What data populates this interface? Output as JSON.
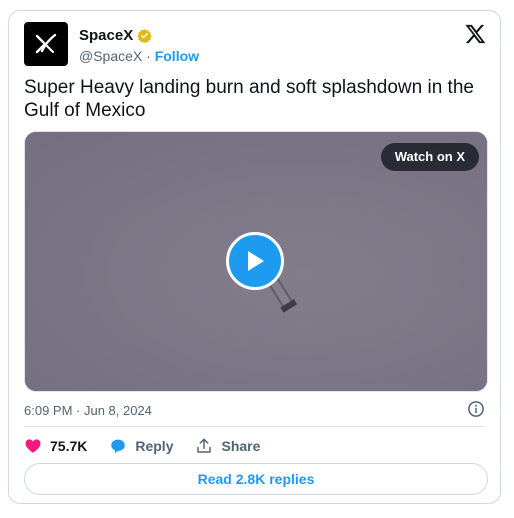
{
  "author": {
    "name": "SpaceX",
    "handle": "@SpaceX",
    "separator": " · ",
    "follow_label": "Follow"
  },
  "tweet": {
    "text": "Super Heavy landing burn and soft splashdown in the Gulf of Mexico",
    "timestamp": "6:09 PM · Jun 8, 2024"
  },
  "media": {
    "watch_label": "Watch on X"
  },
  "actions": {
    "likes": "75.7K",
    "reply_label": "Reply",
    "share_label": "Share"
  },
  "replies_button": "Read 2.8K replies",
  "colors": {
    "accent": "#1d9bf0",
    "like": "#f91880",
    "verified": "#e2b719",
    "text": "#0f1419",
    "muted": "#536471"
  },
  "icons": [
    "spacex-logo-icon",
    "verified-badge-icon",
    "x-logo-icon",
    "play-icon",
    "info-icon",
    "heart-icon",
    "reply-icon",
    "share-icon"
  ]
}
